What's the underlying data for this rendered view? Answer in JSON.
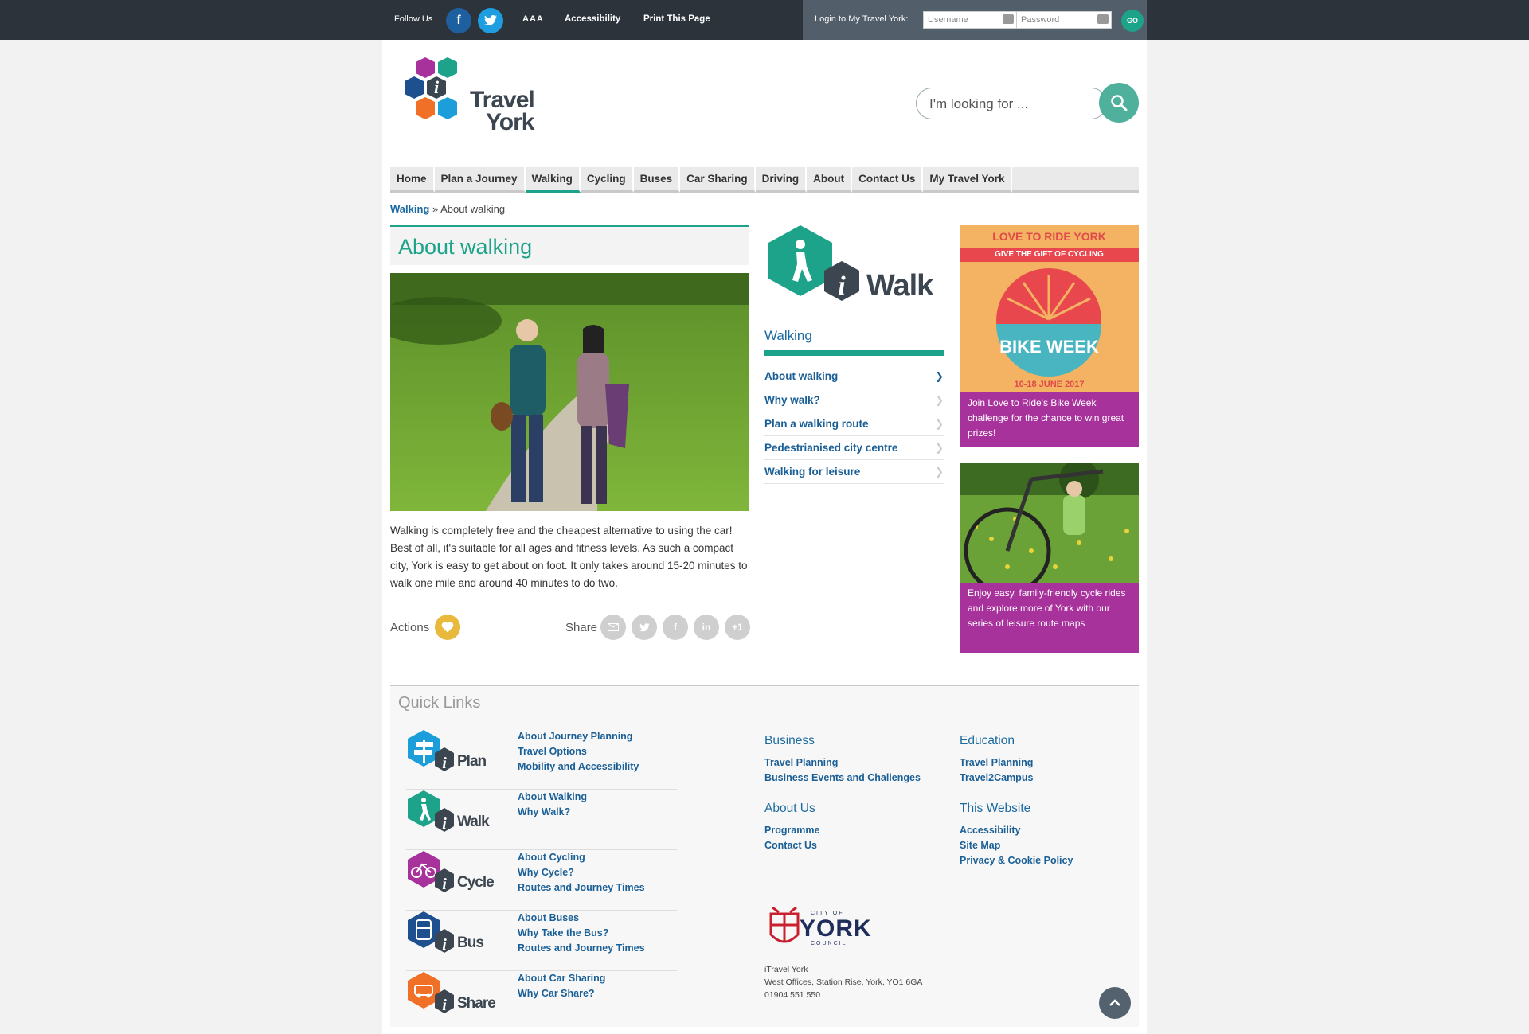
{
  "topbar": {
    "follow_us": "Follow Us",
    "text_size": "AAA",
    "accessibility": "Accessibility",
    "print": "Print This Page",
    "login_label": "Login to My Travel York:",
    "username_placeholder": "Username",
    "password_placeholder": "Password",
    "go": "GO"
  },
  "logo": {
    "line1": "Travel",
    "line2": "York",
    "i": "i"
  },
  "search": {
    "placeholder": "I'm looking for ..."
  },
  "nav": [
    {
      "label": "Home"
    },
    {
      "label": "Plan a Journey"
    },
    {
      "label": "Walking",
      "active": true
    },
    {
      "label": "Cycling"
    },
    {
      "label": "Buses"
    },
    {
      "label": "Car Sharing"
    },
    {
      "label": "Driving"
    },
    {
      "label": "About"
    },
    {
      "label": "Contact Us"
    },
    {
      "label": "My Travel York"
    }
  ],
  "breadcrumb": {
    "parent": "Walking",
    "sep": "»",
    "current": "About walking"
  },
  "main": {
    "title": "About walking",
    "body": "Walking is completely free and the cheapest alternative to using the car! Best of all, it's suitable for all ages and fitness levels. As such a compact city, York is easy to get about on foot. It only takes around 15-20 minutes to walk one mile and around 40 minutes to do two.",
    "actions_label": "Actions",
    "share_label": "Share"
  },
  "section": {
    "badge_text": "Walk",
    "title": "Walking",
    "items": [
      {
        "label": "About walking",
        "active": true
      },
      {
        "label": "Why walk?"
      },
      {
        "label": "Plan a walking route"
      },
      {
        "label": "Pedestrianised city centre"
      },
      {
        "label": "Walking for leisure"
      }
    ]
  },
  "promos": {
    "p1_brand": "LOVE TO RIDE YORK",
    "p1_band": "GIVE THE GIFT OF CYCLING",
    "p1_badge": "BIKE WEEK",
    "p1_dates": "10-18 JUNE 2017",
    "p1_caption": "Join Love to Ride's Bike Week challenge for the chance to win great prizes!",
    "p2_caption": "Enjoy easy, family-friendly cycle rides and explore more of York with our series of leisure route maps"
  },
  "quicklinks": {
    "title": "Quick Links",
    "rows": [
      {
        "badge": "Plan",
        "color": "#1b9ed9",
        "links": [
          "About Journey Planning",
          "Travel Options",
          "Mobility and Accessibility"
        ]
      },
      {
        "badge": "Walk",
        "color": "#1ca38a",
        "links": [
          "About Walking",
          "Why Walk?"
        ]
      },
      {
        "badge": "Cycle",
        "color": "#a8329c",
        "links": [
          "About Cycling",
          "Why Cycle?",
          "Routes and Journey Times"
        ]
      },
      {
        "badge": "Bus",
        "color": "#1e4f8f",
        "links": [
          "About Buses",
          "Why Take the Bus?",
          "Routes and Journey Times"
        ]
      },
      {
        "badge": "Share",
        "color": "#ef7026",
        "links": [
          "About Car Sharing",
          "Why Car Share?"
        ]
      }
    ],
    "business": {
      "title": "Business",
      "links": [
        "Travel Planning",
        "Business Events and Challenges"
      ]
    },
    "education": {
      "title": "Education",
      "links": [
        "Travel Planning",
        "Travel2Campus"
      ]
    },
    "about": {
      "title": "About Us",
      "links": [
        "Programme",
        "Contact Us"
      ]
    },
    "website": {
      "title": "This Website",
      "links": [
        "Accessibility",
        "Site Map",
        "Privacy & Cookie Policy"
      ]
    }
  },
  "footer": {
    "council_small": "CITY OF",
    "council_big": "YORK",
    "council_sub": "COUNCIL",
    "address1": "iTravel York",
    "address2": "West Offices, Station Rise, York, YO1 6GA",
    "phone": "01904 551 550"
  }
}
